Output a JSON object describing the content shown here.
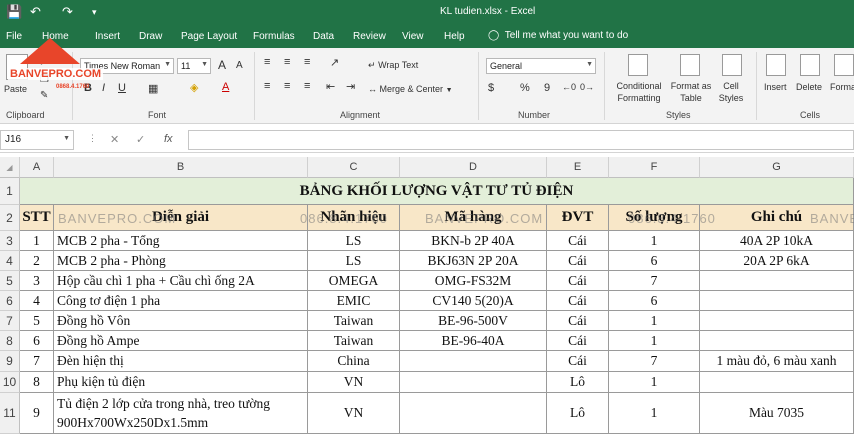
{
  "window": {
    "title": "KL tudien.xlsx - Excel"
  },
  "ribbon_tabs": [
    "File",
    "Home",
    "Insert",
    "Draw",
    "Page Layout",
    "Formulas",
    "Data",
    "Review",
    "View",
    "Help"
  ],
  "tell_me": "Tell me what you want to do",
  "logo": {
    "text": "BANVEPRO.COM",
    "phone": "0868.4.1760"
  },
  "clipboard": {
    "paste": "Paste",
    "label": "Clipboard"
  },
  "font": {
    "name": "Times New Roman",
    "size": "11",
    "label": "Font",
    "bold": "B",
    "italic": "I",
    "underline": "U",
    "grow": "A",
    "shrink": "A"
  },
  "alignment": {
    "wrap_text": "Wrap Text",
    "merge_center": "Merge & Center",
    "label": "Alignment"
  },
  "number": {
    "format": "General",
    "label": "Number",
    "currency": "$",
    "percent": "%",
    "comma": "9"
  },
  "styles": {
    "conditional": "Conditional Formatting",
    "format_table": "Format as Table",
    "cell_styles": "Cell Styles",
    "label": "Styles"
  },
  "cells": {
    "insert": "Insert",
    "delete": "Delete",
    "format": "Format",
    "label": "Cells"
  },
  "formula_bar": {
    "name_box": "J16",
    "cancel": "✕",
    "enter": "✓",
    "fx": "fx",
    "value": ""
  },
  "columns": [
    "A",
    "B",
    "C",
    "D",
    "E",
    "F",
    "G"
  ],
  "row_numbers": [
    "1",
    "2",
    "3",
    "4",
    "5",
    "6",
    "7",
    "8",
    "9",
    "10",
    "11"
  ],
  "sheet": {
    "title": "BẢNG KHỐI LƯỢNG VẬT TƯ TỦ ĐIỆN",
    "headers": [
      "STT",
      "Diễn giải",
      "Nhãn hiệu",
      "Mã hàng",
      "ĐVT",
      "Số lượng",
      "Ghi chú"
    ],
    "rows": [
      [
        "1",
        "MCB 2 pha - Tổng",
        "LS",
        "BKN-b 2P 40A",
        "Cái",
        "1",
        "40A 2P 10kA"
      ],
      [
        "2",
        "MCB 2 pha - Phòng",
        "LS",
        "BKJ63N 2P 20A",
        "Cái",
        "6",
        "20A 2P 6kA"
      ],
      [
        "3",
        "Hộp cầu chì 1 pha + Cầu chì ống 2A",
        "OMEGA",
        "OMG-FS32M",
        "Cái",
        "7",
        ""
      ],
      [
        "4",
        "Công tơ điện 1 pha",
        "EMIC",
        "CV140 5(20)A",
        "Cái",
        "6",
        ""
      ],
      [
        "5",
        "Đồng hồ Vôn",
        "Taiwan",
        "BE-96-500V",
        "Cái",
        "1",
        ""
      ],
      [
        "6",
        "Đồng hồ Ampe",
        "Taiwan",
        "BE-96-40A",
        "Cái",
        "1",
        ""
      ],
      [
        "7",
        "Đèn hiện thị",
        "China",
        "",
        "Cái",
        "7",
        "1 màu đỏ, 6 màu xanh"
      ],
      [
        "8",
        "Phụ kiện tủ điện",
        "VN",
        "",
        "Lô",
        "1",
        ""
      ],
      [
        "9",
        "Tủ điện 2 lớp cửa trong nhà, treo tường 900Hx700Wx250Dx1.5mm",
        "VN",
        "",
        "Lô",
        "1",
        "Màu 7035"
      ]
    ]
  },
  "watermarks": [
    "BANVEPRO.COM",
    "086.8.4.1760",
    "BANVEPRO.COM",
    "086.8.4.1760",
    "BANVE"
  ]
}
